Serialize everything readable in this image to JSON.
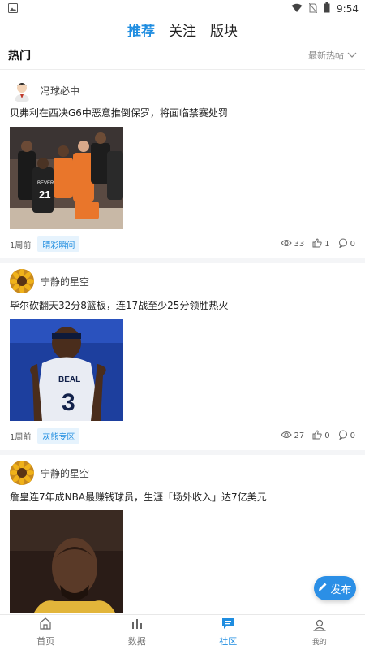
{
  "status_bar": {
    "time": "9:54"
  },
  "top_tabs": [
    {
      "label": "推荐",
      "active": true
    },
    {
      "label": "关注",
      "active": false
    },
    {
      "label": "版块",
      "active": false
    }
  ],
  "section": {
    "title": "热门",
    "sort_label": "最新热帖"
  },
  "posts": [
    {
      "author": "冯球必中",
      "title": "贝弗利在西决G6中恶意推倒保罗，将面临禁赛处罚",
      "time": "1周前",
      "tag": "晴彩瞬间",
      "views": "33",
      "likes": "1",
      "comments": "0",
      "image_desc": "basketball-players-jersey-21"
    },
    {
      "author": "宁静的星空",
      "title": "毕尔砍翻天32分8篮板，连17战至少25分领胜热火",
      "time": "1周前",
      "tag": "灰熊专区",
      "views": "27",
      "likes": "0",
      "comments": "0",
      "image_desc": "player-beal-jersey-3"
    },
    {
      "author": "宁静的星空",
      "title": "詹皇连7年成NBA最赚钱球员，生涯「场外收入」达7亿美元",
      "image_desc": "player-lebron"
    }
  ],
  "image_text": {
    "jersey_21_name": "BEVERLEY",
    "jersey_21_num": "21",
    "jersey_3_name": "BEAL",
    "jersey_3_num": "3"
  },
  "publish_button": {
    "label": "发布"
  },
  "bottom_nav": [
    {
      "label": "首页",
      "icon": "home-icon",
      "active": false
    },
    {
      "label": "数据",
      "icon": "chart-icon",
      "active": false
    },
    {
      "label": "社区",
      "icon": "chat-icon",
      "active": true
    },
    {
      "label": "我的",
      "icon": "person-icon",
      "active": false
    }
  ],
  "colors": {
    "accent": "#1f8de0",
    "tag_bg": "#e6f3fd",
    "divider": "#f4f5f7"
  }
}
